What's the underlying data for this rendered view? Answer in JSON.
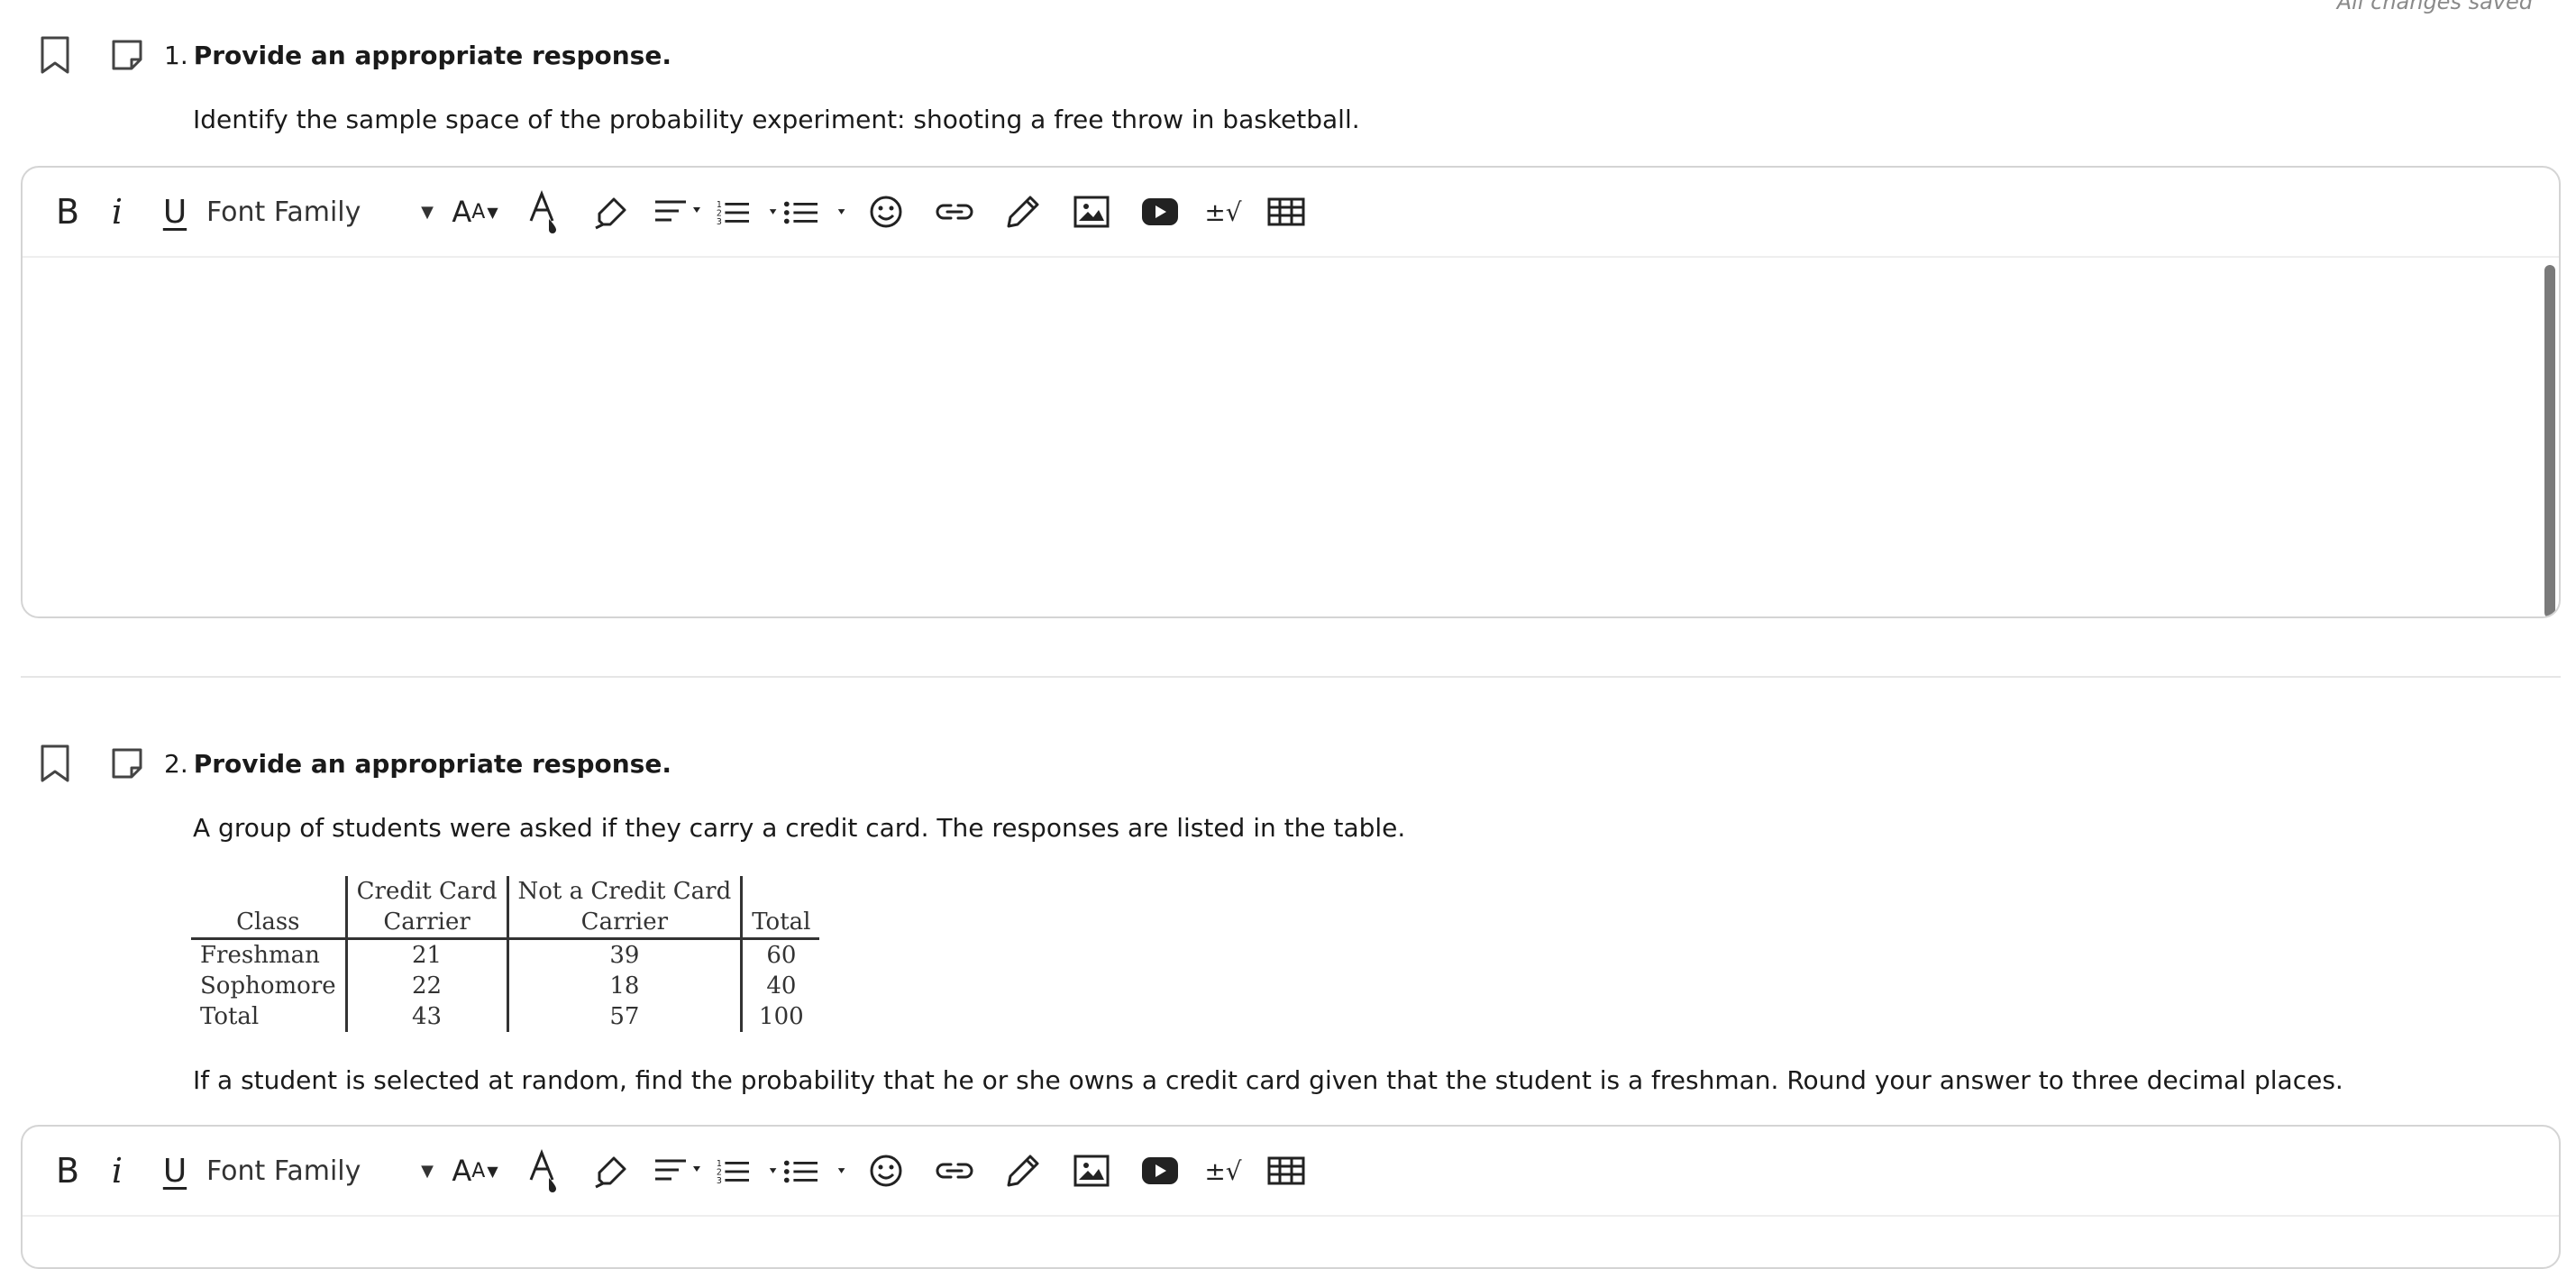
{
  "status": "All changes saved",
  "questions": [
    {
      "number": "1.",
      "title": "Provide an appropriate response.",
      "text": "Identify the sample space of the probability experiment: shooting a free throw in basketball."
    },
    {
      "number": "2.",
      "title": "Provide an appropriate response.",
      "intro": "A group of students were asked if they carry a credit card. The responses are listed in the table.",
      "table": {
        "header_top": [
          "",
          "Credit Card",
          "Not a Credit Card",
          ""
        ],
        "header_bottom": [
          "Class",
          "Carrier",
          "Carrier",
          "Total"
        ],
        "rows": [
          [
            "Freshman",
            "21",
            "39",
            "60"
          ],
          [
            "Sophomore",
            "22",
            "18",
            "40"
          ],
          [
            "Total",
            "43",
            "57",
            "100"
          ]
        ]
      },
      "text": "If a student is selected at random, find the probability that he or she owns a credit card given that the student is a freshman. Round your answer to three decimal places."
    }
  ],
  "toolbar": {
    "bold": "B",
    "italic": "i",
    "underline": "U",
    "font_family": "Font Family",
    "font_size_big": "A",
    "font_size_small": "A",
    "math": "±√",
    "icons": [
      "bold-icon",
      "italic-icon",
      "underline-icon",
      "font-size-icon",
      "text-color-icon",
      "highlight-icon",
      "align-icon",
      "ordered-list-icon",
      "unordered-list-icon",
      "emoji-icon",
      "link-icon",
      "draw-icon",
      "image-icon",
      "video-icon",
      "math-icon",
      "table-icon"
    ]
  }
}
